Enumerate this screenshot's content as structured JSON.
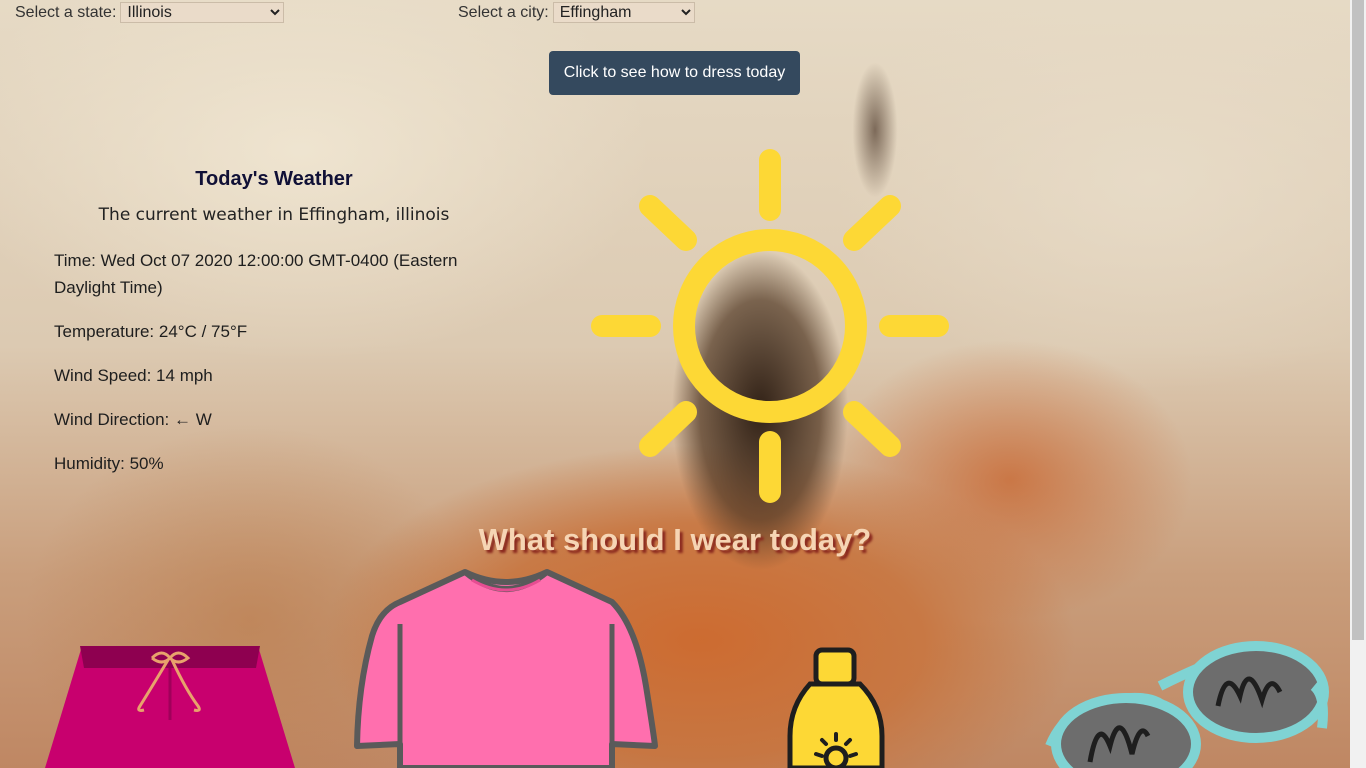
{
  "selectors": {
    "state_label": "Select a state:",
    "state_value": "Illinois",
    "city_label": "Select a city:",
    "city_value": "Effingham"
  },
  "button": {
    "label": "Click to see how to dress today"
  },
  "weather": {
    "heading": "Today's Weather",
    "subtitle": "The current weather in Effingham, illinois",
    "time": "Time: Wed Oct 07 2020 12:00:00 GMT-0400 (Eastern Daylight Time)",
    "temperature": "Temperature: 24°C / 75°F",
    "wind_speed": "Wind Speed: 14 mph",
    "wind_direction": "Wind Direction: ← W",
    "humidity": "Humidity: 50%"
  },
  "weather_icon": "sun-icon",
  "wear_heading": "What should I wear today?",
  "clothing_icons": [
    "shorts-icon",
    "tshirt-icon",
    "sunscreen-icon",
    "sunglasses-icon"
  ],
  "colors": {
    "button_bg": "#34495e",
    "sun": "#fdd835",
    "shirt": "#ff6fae",
    "shorts": "#c8006e"
  }
}
